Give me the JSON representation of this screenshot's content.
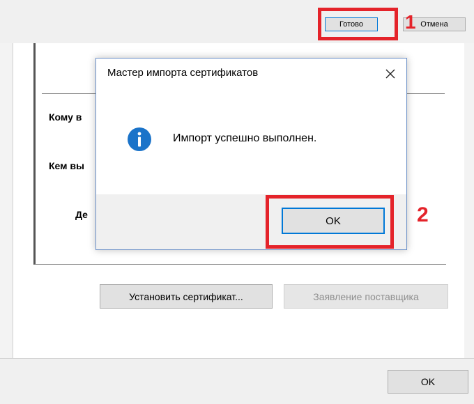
{
  "wizard_header": {
    "done_label": "Готово",
    "cancel_label": "Отмена"
  },
  "certificate": {
    "issued_to_label": "Кому в",
    "issued_by_label": "Кем вы",
    "valid_label": "Де"
  },
  "actions": {
    "install_label": "Установить сертификат...",
    "supplier_label": "Заявление поставщика",
    "ok_label": "OK"
  },
  "dialog": {
    "title": "Мастер импорта сертификатов",
    "close_glyph": "✕",
    "icon": "info-icon",
    "message": "Импорт успешно выполнен.",
    "ok_label": "OK"
  },
  "annotations": {
    "step1": "1",
    "step2": "2",
    "color": "#e4232a"
  }
}
